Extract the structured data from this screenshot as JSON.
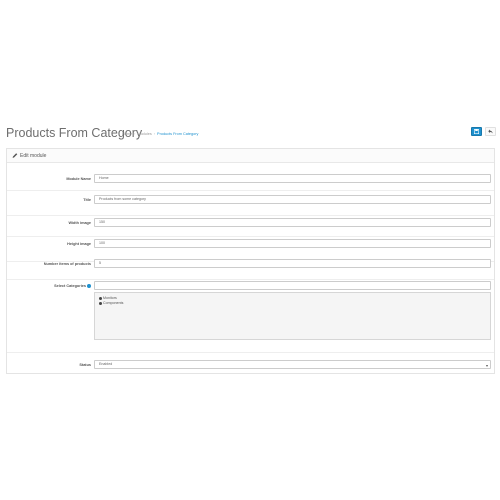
{
  "header": {
    "title": "Products From Category",
    "breadcrumb": [
      "Home",
      "Modules",
      "Products From Category"
    ]
  },
  "panel": {
    "title": "Edit module",
    "icon": "pencil-icon"
  },
  "form": {
    "module_name": {
      "label": "Module Name",
      "value": "Home"
    },
    "title": {
      "label": "Title",
      "value": "Products from some category"
    },
    "width_image": {
      "label": "Width image",
      "value": "150"
    },
    "height_image": {
      "label": "Height image",
      "value": "100"
    },
    "number_items": {
      "label": "Number items of products",
      "value": "5"
    },
    "categories": {
      "label": "Select Categories",
      "value": "",
      "items": [
        "Monitors",
        "Components"
      ]
    },
    "status": {
      "label": "Status",
      "value": "Enabled"
    }
  },
  "colors": {
    "primary": "#1e91cf",
    "text": "#555555",
    "border": "#cccccc"
  },
  "icons": {
    "save": "save-icon",
    "back": "reply-icon",
    "help": "help-icon",
    "category_item": "minus-circle-icon"
  }
}
